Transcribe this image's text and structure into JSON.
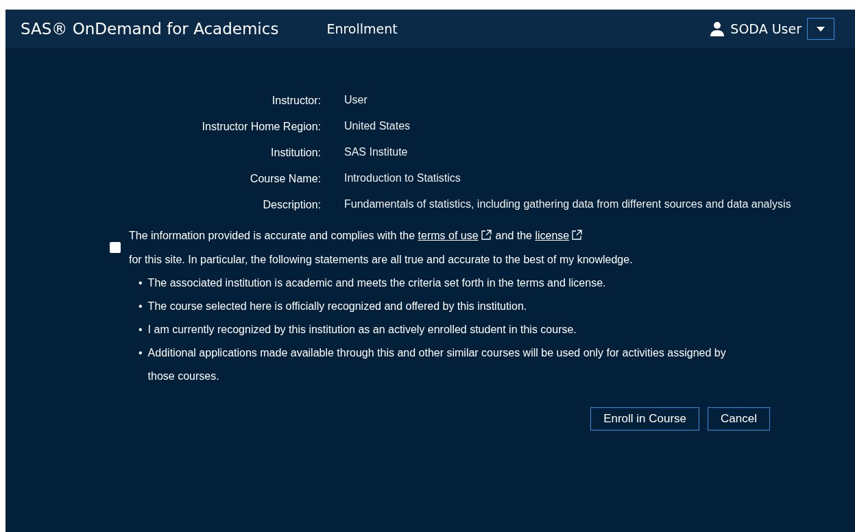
{
  "header": {
    "brand": "SAS® OnDemand for Academics",
    "page_title": "Enrollment",
    "user": "SODA User"
  },
  "details": [
    {
      "label": "Instructor:",
      "value": "User"
    },
    {
      "label": "Instructor Home Region:",
      "value": "United States"
    },
    {
      "label": "Institution:",
      "value": "SAS Institute"
    },
    {
      "label": "Course Name:",
      "value": "Introduction to Statistics"
    },
    {
      "label": "Description:",
      "value": "Fundamentals of statistics, including gathering data from different sources and data analysis"
    }
  ],
  "consent": {
    "checked": false,
    "text_before": "The information provided is accurate and complies with the",
    "link_1": "terms of use",
    "text_middle": "and the",
    "link_2": "license",
    "text_after": "for this site. In particular, the following statements are all true and accurate to the best of my knowledge."
  },
  "statements": [
    {
      "marker": "•",
      "text": "The associated institution is academic and meets the criteria set forth in the terms and license."
    },
    {
      "marker": "•",
      "text": "The course selected here is officially recognized and offered by this institution."
    },
    {
      "marker": "•",
      "text": "I am currently recognized by this institution as an actively enrolled student in this course."
    },
    {
      "marker": "•",
      "text": "Additional applications made available through this and other similar courses will be used only for activities assigned by those courses."
    }
  ],
  "buttons": [
    "Enroll in Course",
    "Cancel"
  ]
}
